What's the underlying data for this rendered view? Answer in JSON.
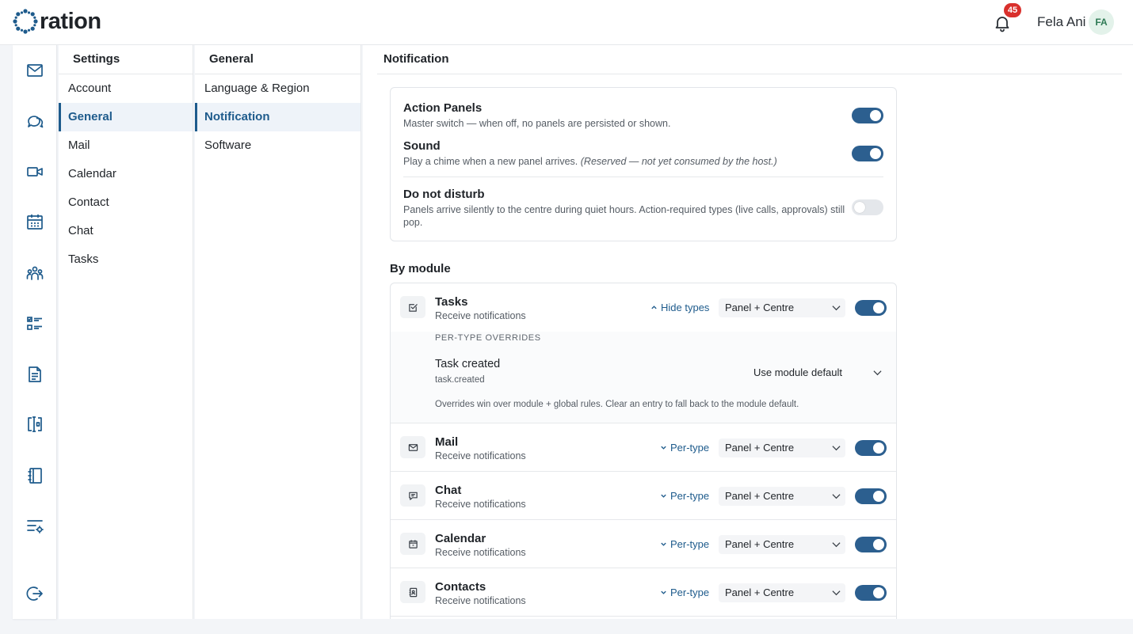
{
  "header": {
    "logo_text": "ration",
    "notifications_count": "45",
    "user_name": "Fela Ani",
    "user_initials": "FA"
  },
  "icon_rail": [
    "mail-icon",
    "chat-icon",
    "video-icon",
    "calendar-icon",
    "contacts-icon",
    "tasks-icon",
    "document-icon",
    "whiteboard-icon",
    "notebook-icon",
    "settings-list-icon",
    "logout-icon"
  ],
  "settings_nav": {
    "title": "Settings",
    "items": [
      {
        "label": "Account"
      },
      {
        "label": "General",
        "active": true
      },
      {
        "label": "Mail"
      },
      {
        "label": "Calendar"
      },
      {
        "label": "Contact"
      },
      {
        "label": "Chat"
      },
      {
        "label": "Tasks"
      }
    ]
  },
  "general_nav": {
    "title": "General",
    "items": [
      {
        "label": "Language & Region"
      },
      {
        "label": "Notification",
        "active": true
      },
      {
        "label": "Software"
      }
    ]
  },
  "main": {
    "title": "Notification",
    "global": {
      "action_panels": {
        "title": "Action Panels",
        "desc": "Master switch — when off, no panels are persisted or shown.",
        "enabled": true
      },
      "sound": {
        "title": "Sound",
        "desc": "Play a chime when a new panel arrives.",
        "desc_note": "(Reserved — not yet consumed by the host.)",
        "enabled": true
      },
      "dnd": {
        "title": "Do not disturb",
        "desc": "Panels arrive silently to the centre during quiet hours. Action-required types (live calls, approvals) still pop.",
        "enabled": false
      }
    },
    "by_module_title": "By module",
    "modules": [
      {
        "title": "Tasks",
        "desc": "Receive notifications",
        "link": "Hide types",
        "mode": "Panel + Centre",
        "enabled": true,
        "icon": "task-check-icon"
      },
      {
        "title": "Mail",
        "desc": "Receive notifications",
        "link": "Per-type",
        "mode": "Panel + Centre",
        "enabled": true,
        "icon": "mail-icon"
      },
      {
        "title": "Chat",
        "desc": "Receive notifications",
        "link": "Per-type",
        "mode": "Panel + Centre",
        "enabled": true,
        "icon": "chat-icon"
      },
      {
        "title": "Calendar",
        "desc": "Receive notifications",
        "link": "Per-type",
        "mode": "Panel + Centre",
        "enabled": true,
        "icon": "calendar-icon"
      },
      {
        "title": "Contacts",
        "desc": "Receive notifications",
        "link": "Per-type",
        "mode": "Panel + Centre",
        "enabled": true,
        "icon": "contact-card-icon"
      }
    ],
    "overrides": {
      "label": "PER-TYPE OVERRIDES",
      "item_title": "Task created",
      "item_key": "task.created",
      "item_mode": "Use module default",
      "note": "Overrides win over module + global rules. Clear an entry to fall back to the module default."
    }
  },
  "colors": {
    "accent": "#1e5b8c",
    "toggle_on": "#2c5f8f",
    "toggle_off": "#e4e7eb",
    "badge": "#d9302c"
  }
}
